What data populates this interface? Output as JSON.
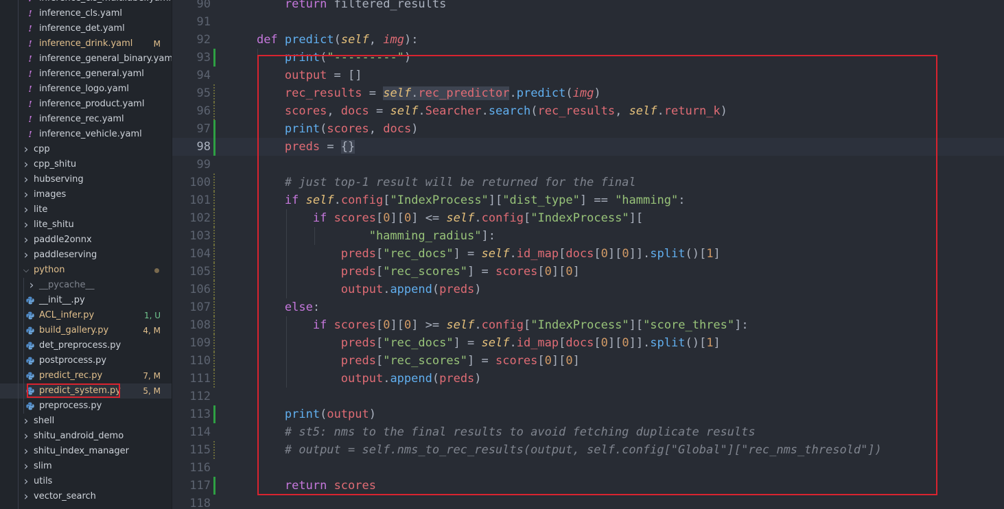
{
  "explorer": {
    "items": [
      {
        "name": "inference_cls_multilabel.yaml",
        "kind": "yaml",
        "badge": ""
      },
      {
        "name": "inference_cls.yaml",
        "kind": "yaml",
        "badge": ""
      },
      {
        "name": "inference_det.yaml",
        "kind": "yaml",
        "badge": ""
      },
      {
        "name": "inference_drink.yaml",
        "kind": "yaml",
        "badge": "M"
      },
      {
        "name": "inference_general_binary.yaml",
        "kind": "yaml",
        "badge": ""
      },
      {
        "name": "inference_general.yaml",
        "kind": "yaml",
        "badge": ""
      },
      {
        "name": "inference_logo.yaml",
        "kind": "yaml",
        "badge": ""
      },
      {
        "name": "inference_product.yaml",
        "kind": "yaml",
        "badge": ""
      },
      {
        "name": "inference_rec.yaml",
        "kind": "yaml",
        "badge": ""
      },
      {
        "name": "inference_vehicle.yaml",
        "kind": "yaml",
        "badge": ""
      },
      {
        "name": "cpp",
        "kind": "folder",
        "badge": ""
      },
      {
        "name": "cpp_shitu",
        "kind": "folder",
        "badge": ""
      },
      {
        "name": "hubserving",
        "kind": "folder",
        "badge": ""
      },
      {
        "name": "images",
        "kind": "folder",
        "badge": ""
      },
      {
        "name": "lite",
        "kind": "folder",
        "badge": ""
      },
      {
        "name": "lite_shitu",
        "kind": "folder",
        "badge": ""
      },
      {
        "name": "paddle2onnx",
        "kind": "folder",
        "badge": ""
      },
      {
        "name": "paddleserving",
        "kind": "folder",
        "badge": ""
      },
      {
        "name": "python",
        "kind": "folder-open",
        "badge": "dot"
      },
      {
        "name": "__pycache__",
        "kind": "subfolder",
        "badge": ""
      },
      {
        "name": "__init__.py",
        "kind": "py",
        "badge": ""
      },
      {
        "name": "ACL_infer.py",
        "kind": "py",
        "badge": "1, U"
      },
      {
        "name": "build_gallery.py",
        "kind": "py",
        "badge": "4, M"
      },
      {
        "name": "det_preprocess.py",
        "kind": "py",
        "badge": ""
      },
      {
        "name": "postprocess.py",
        "kind": "py",
        "badge": ""
      },
      {
        "name": "predict_rec.py",
        "kind": "py",
        "badge": "7, M"
      },
      {
        "name": "predict_system.py",
        "kind": "py",
        "badge": "5, M"
      },
      {
        "name": "preprocess.py",
        "kind": "py",
        "badge": ""
      },
      {
        "name": "shell",
        "kind": "folder",
        "badge": ""
      },
      {
        "name": "shitu_android_demo",
        "kind": "folder",
        "badge": ""
      },
      {
        "name": "shitu_index_manager",
        "kind": "folder",
        "badge": ""
      },
      {
        "name": "slim",
        "kind": "folder",
        "badge": ""
      },
      {
        "name": "utils",
        "kind": "folder",
        "badge": ""
      },
      {
        "name": "vector_search",
        "kind": "folder",
        "badge": ""
      }
    ],
    "selected": "predict_system.py"
  },
  "editor": {
    "current_line": 98,
    "lines": [
      {
        "n": "90",
        "gutter": "",
        "t": [
          [
            "        ",
            ""
          ],
          [
            "return",
            "k"
          ],
          [
            " filtered_results",
            "p"
          ]
        ]
      },
      {
        "n": "91",
        "gutter": "",
        "t": []
      },
      {
        "n": "92",
        "gutter": "",
        "t": [
          [
            "    ",
            ""
          ],
          [
            "def",
            "k"
          ],
          [
            " ",
            ""
          ],
          [
            "predict",
            "f"
          ],
          [
            "(",
            "p"
          ],
          [
            "self",
            "sf"
          ],
          [
            ", ",
            "p"
          ],
          [
            "img",
            "pi"
          ],
          [
            "):",
            "p"
          ]
        ]
      },
      {
        "n": "93",
        "gutter": "add",
        "t": [
          [
            "        ",
            ""
          ],
          [
            "print",
            "f"
          ],
          [
            "(",
            "p"
          ],
          [
            "\"---------\"",
            "s"
          ],
          [
            ")",
            "p"
          ]
        ]
      },
      {
        "n": "94",
        "gutter": "",
        "t": [
          [
            "        ",
            ""
          ],
          [
            "output",
            "v"
          ],
          [
            " = []",
            "p"
          ]
        ]
      },
      {
        "n": "95",
        "gutter": "mod",
        "t": [
          [
            "        ",
            ""
          ],
          [
            "rec_results",
            "v"
          ],
          [
            " = ",
            "p"
          ],
          [
            "self",
            "sf hl"
          ],
          [
            ".",
            "p hl"
          ],
          [
            "rec_predictor",
            "v hl"
          ],
          [
            ".",
            "p"
          ],
          [
            "predict",
            "f"
          ],
          [
            "(",
            "p"
          ],
          [
            "img",
            "pi"
          ],
          [
            ")",
            "p"
          ]
        ]
      },
      {
        "n": "96",
        "gutter": "mod",
        "t": [
          [
            "        ",
            ""
          ],
          [
            "scores",
            "v"
          ],
          [
            ", ",
            "p"
          ],
          [
            "docs",
            "v"
          ],
          [
            " = ",
            "p"
          ],
          [
            "self",
            "sf"
          ],
          [
            ".",
            "p"
          ],
          [
            "Searcher",
            "v"
          ],
          [
            ".",
            "p"
          ],
          [
            "search",
            "f"
          ],
          [
            "(",
            "p"
          ],
          [
            "rec_results",
            "v"
          ],
          [
            ", ",
            "p"
          ],
          [
            "self",
            "sf"
          ],
          [
            ".",
            "p"
          ],
          [
            "return_k",
            "v"
          ],
          [
            ")",
            "p"
          ]
        ]
      },
      {
        "n": "97",
        "gutter": "add",
        "t": [
          [
            "        ",
            ""
          ],
          [
            "print",
            "f"
          ],
          [
            "(",
            "p"
          ],
          [
            "scores",
            "v"
          ],
          [
            ", ",
            "p"
          ],
          [
            "docs",
            "v"
          ],
          [
            ")",
            "p"
          ]
        ]
      },
      {
        "n": "98",
        "gutter": "add",
        "t": [
          [
            "        ",
            ""
          ],
          [
            "preds",
            "v"
          ],
          [
            " = ",
            "p"
          ],
          [
            "{}",
            "p hl"
          ]
        ]
      },
      {
        "n": "99",
        "gutter": "",
        "t": []
      },
      {
        "n": "100",
        "gutter": "mod",
        "t": [
          [
            "        ",
            ""
          ],
          [
            "# just top-1 result will be returned for the final",
            "c"
          ]
        ]
      },
      {
        "n": "101",
        "gutter": "mod",
        "t": [
          [
            "        ",
            ""
          ],
          [
            "if",
            "k"
          ],
          [
            " ",
            ""
          ],
          [
            "self",
            "sf"
          ],
          [
            ".",
            "p"
          ],
          [
            "config",
            "v"
          ],
          [
            "[",
            "p"
          ],
          [
            "\"IndexProcess\"",
            "s"
          ],
          [
            "][",
            "p"
          ],
          [
            "\"dist_type\"",
            "s"
          ],
          [
            "] == ",
            "p"
          ],
          [
            "\"hamming\"",
            "s"
          ],
          [
            ":",
            "p"
          ]
        ]
      },
      {
        "n": "102",
        "gutter": "mod",
        "t": [
          [
            "            ",
            ""
          ],
          [
            "if",
            "k"
          ],
          [
            " ",
            ""
          ],
          [
            "scores",
            "v"
          ],
          [
            "[",
            "p"
          ],
          [
            "0",
            "n"
          ],
          [
            "][",
            "p"
          ],
          [
            "0",
            "n"
          ],
          [
            "] <= ",
            "p"
          ],
          [
            "self",
            "sf"
          ],
          [
            ".",
            "p"
          ],
          [
            "config",
            "v"
          ],
          [
            "[",
            "p"
          ],
          [
            "\"IndexProcess\"",
            "s"
          ],
          [
            "][",
            "p"
          ]
        ]
      },
      {
        "n": "103",
        "gutter": "mod",
        "t": [
          [
            "                    ",
            ""
          ],
          [
            "\"hamming_radius\"",
            "s"
          ],
          [
            "]:",
            "p"
          ]
        ]
      },
      {
        "n": "104",
        "gutter": "mod",
        "t": [
          [
            "                ",
            ""
          ],
          [
            "preds",
            "v"
          ],
          [
            "[",
            "p"
          ],
          [
            "\"rec_docs\"",
            "s"
          ],
          [
            "] = ",
            "p"
          ],
          [
            "self",
            "sf"
          ],
          [
            ".",
            "p"
          ],
          [
            "id_map",
            "v"
          ],
          [
            "[",
            "p"
          ],
          [
            "docs",
            "v"
          ],
          [
            "[",
            "p"
          ],
          [
            "0",
            "n"
          ],
          [
            "][",
            "p"
          ],
          [
            "0",
            "n"
          ],
          [
            "]].",
            "p"
          ],
          [
            "split",
            "f"
          ],
          [
            "()[",
            "p"
          ],
          [
            "1",
            "n"
          ],
          [
            "]",
            "p"
          ]
        ]
      },
      {
        "n": "105",
        "gutter": "mod",
        "t": [
          [
            "                ",
            ""
          ],
          [
            "preds",
            "v"
          ],
          [
            "[",
            "p"
          ],
          [
            "\"rec_scores\"",
            "s"
          ],
          [
            "] = ",
            "p"
          ],
          [
            "scores",
            "v"
          ],
          [
            "[",
            "p"
          ],
          [
            "0",
            "n"
          ],
          [
            "][",
            "p"
          ],
          [
            "0",
            "n"
          ],
          [
            "]",
            "p"
          ]
        ]
      },
      {
        "n": "106",
        "gutter": "mod",
        "t": [
          [
            "                ",
            ""
          ],
          [
            "output",
            "v"
          ],
          [
            ".",
            "p"
          ],
          [
            "append",
            "f"
          ],
          [
            "(",
            "p"
          ],
          [
            "preds",
            "v"
          ],
          [
            ")",
            "p"
          ]
        ]
      },
      {
        "n": "107",
        "gutter": "mod",
        "t": [
          [
            "        ",
            ""
          ],
          [
            "else",
            "k"
          ],
          [
            ":",
            "p"
          ]
        ]
      },
      {
        "n": "108",
        "gutter": "mod",
        "t": [
          [
            "            ",
            ""
          ],
          [
            "if",
            "k"
          ],
          [
            " ",
            ""
          ],
          [
            "scores",
            "v"
          ],
          [
            "[",
            "p"
          ],
          [
            "0",
            "n"
          ],
          [
            "][",
            "p"
          ],
          [
            "0",
            "n"
          ],
          [
            "] >= ",
            "p"
          ],
          [
            "self",
            "sf"
          ],
          [
            ".",
            "p"
          ],
          [
            "config",
            "v"
          ],
          [
            "[",
            "p"
          ],
          [
            "\"IndexProcess\"",
            "s"
          ],
          [
            "][",
            "p"
          ],
          [
            "\"score_thres\"",
            "s"
          ],
          [
            "]:",
            "p"
          ]
        ]
      },
      {
        "n": "109",
        "gutter": "mod",
        "t": [
          [
            "                ",
            ""
          ],
          [
            "preds",
            "v"
          ],
          [
            "[",
            "p"
          ],
          [
            "\"rec_docs\"",
            "s"
          ],
          [
            "] = ",
            "p"
          ],
          [
            "self",
            "sf"
          ],
          [
            ".",
            "p"
          ],
          [
            "id_map",
            "v"
          ],
          [
            "[",
            "p"
          ],
          [
            "docs",
            "v"
          ],
          [
            "[",
            "p"
          ],
          [
            "0",
            "n"
          ],
          [
            "][",
            "p"
          ],
          [
            "0",
            "n"
          ],
          [
            "]].",
            "p"
          ],
          [
            "split",
            "f"
          ],
          [
            "()[",
            "p"
          ],
          [
            "1",
            "n"
          ],
          [
            "]",
            "p"
          ]
        ]
      },
      {
        "n": "110",
        "gutter": "mod",
        "t": [
          [
            "                ",
            ""
          ],
          [
            "preds",
            "v"
          ],
          [
            "[",
            "p"
          ],
          [
            "\"rec_scores\"",
            "s"
          ],
          [
            "] = ",
            "p"
          ],
          [
            "scores",
            "v"
          ],
          [
            "[",
            "p"
          ],
          [
            "0",
            "n"
          ],
          [
            "][",
            "p"
          ],
          [
            "0",
            "n"
          ],
          [
            "]",
            "p"
          ]
        ]
      },
      {
        "n": "111",
        "gutter": "mod",
        "t": [
          [
            "                ",
            ""
          ],
          [
            "output",
            "v"
          ],
          [
            ".",
            "p"
          ],
          [
            "append",
            "f"
          ],
          [
            "(",
            "p"
          ],
          [
            "preds",
            "v"
          ],
          [
            ")",
            "p"
          ]
        ]
      },
      {
        "n": "112",
        "gutter": "",
        "t": []
      },
      {
        "n": "113",
        "gutter": "add",
        "t": [
          [
            "        ",
            ""
          ],
          [
            "print",
            "f"
          ],
          [
            "(",
            "p"
          ],
          [
            "output",
            "v"
          ],
          [
            ")",
            "p"
          ]
        ]
      },
      {
        "n": "114",
        "gutter": "",
        "t": [
          [
            "        ",
            ""
          ],
          [
            "# st5: nms to the final results to avoid fetching duplicate results",
            "c"
          ]
        ]
      },
      {
        "n": "115",
        "gutter": "mod",
        "t": [
          [
            "        ",
            ""
          ],
          [
            "# output = self.nms_to_rec_results(output, self.config[\"Global\"][\"rec_nms_thresold\"])",
            "c"
          ]
        ]
      },
      {
        "n": "116",
        "gutter": "",
        "t": []
      },
      {
        "n": "117",
        "gutter": "add",
        "t": [
          [
            "        ",
            ""
          ],
          [
            "return",
            "k"
          ],
          [
            " ",
            ""
          ],
          [
            "scores",
            "v"
          ]
        ]
      },
      {
        "n": "118",
        "gutter": "",
        "t": []
      }
    ]
  },
  "colors": {
    "annotation_red": "#d9232f",
    "added_line": "#2ea043",
    "modified_badge": "#e2c08d",
    "untracked_badge": "#73c991"
  }
}
